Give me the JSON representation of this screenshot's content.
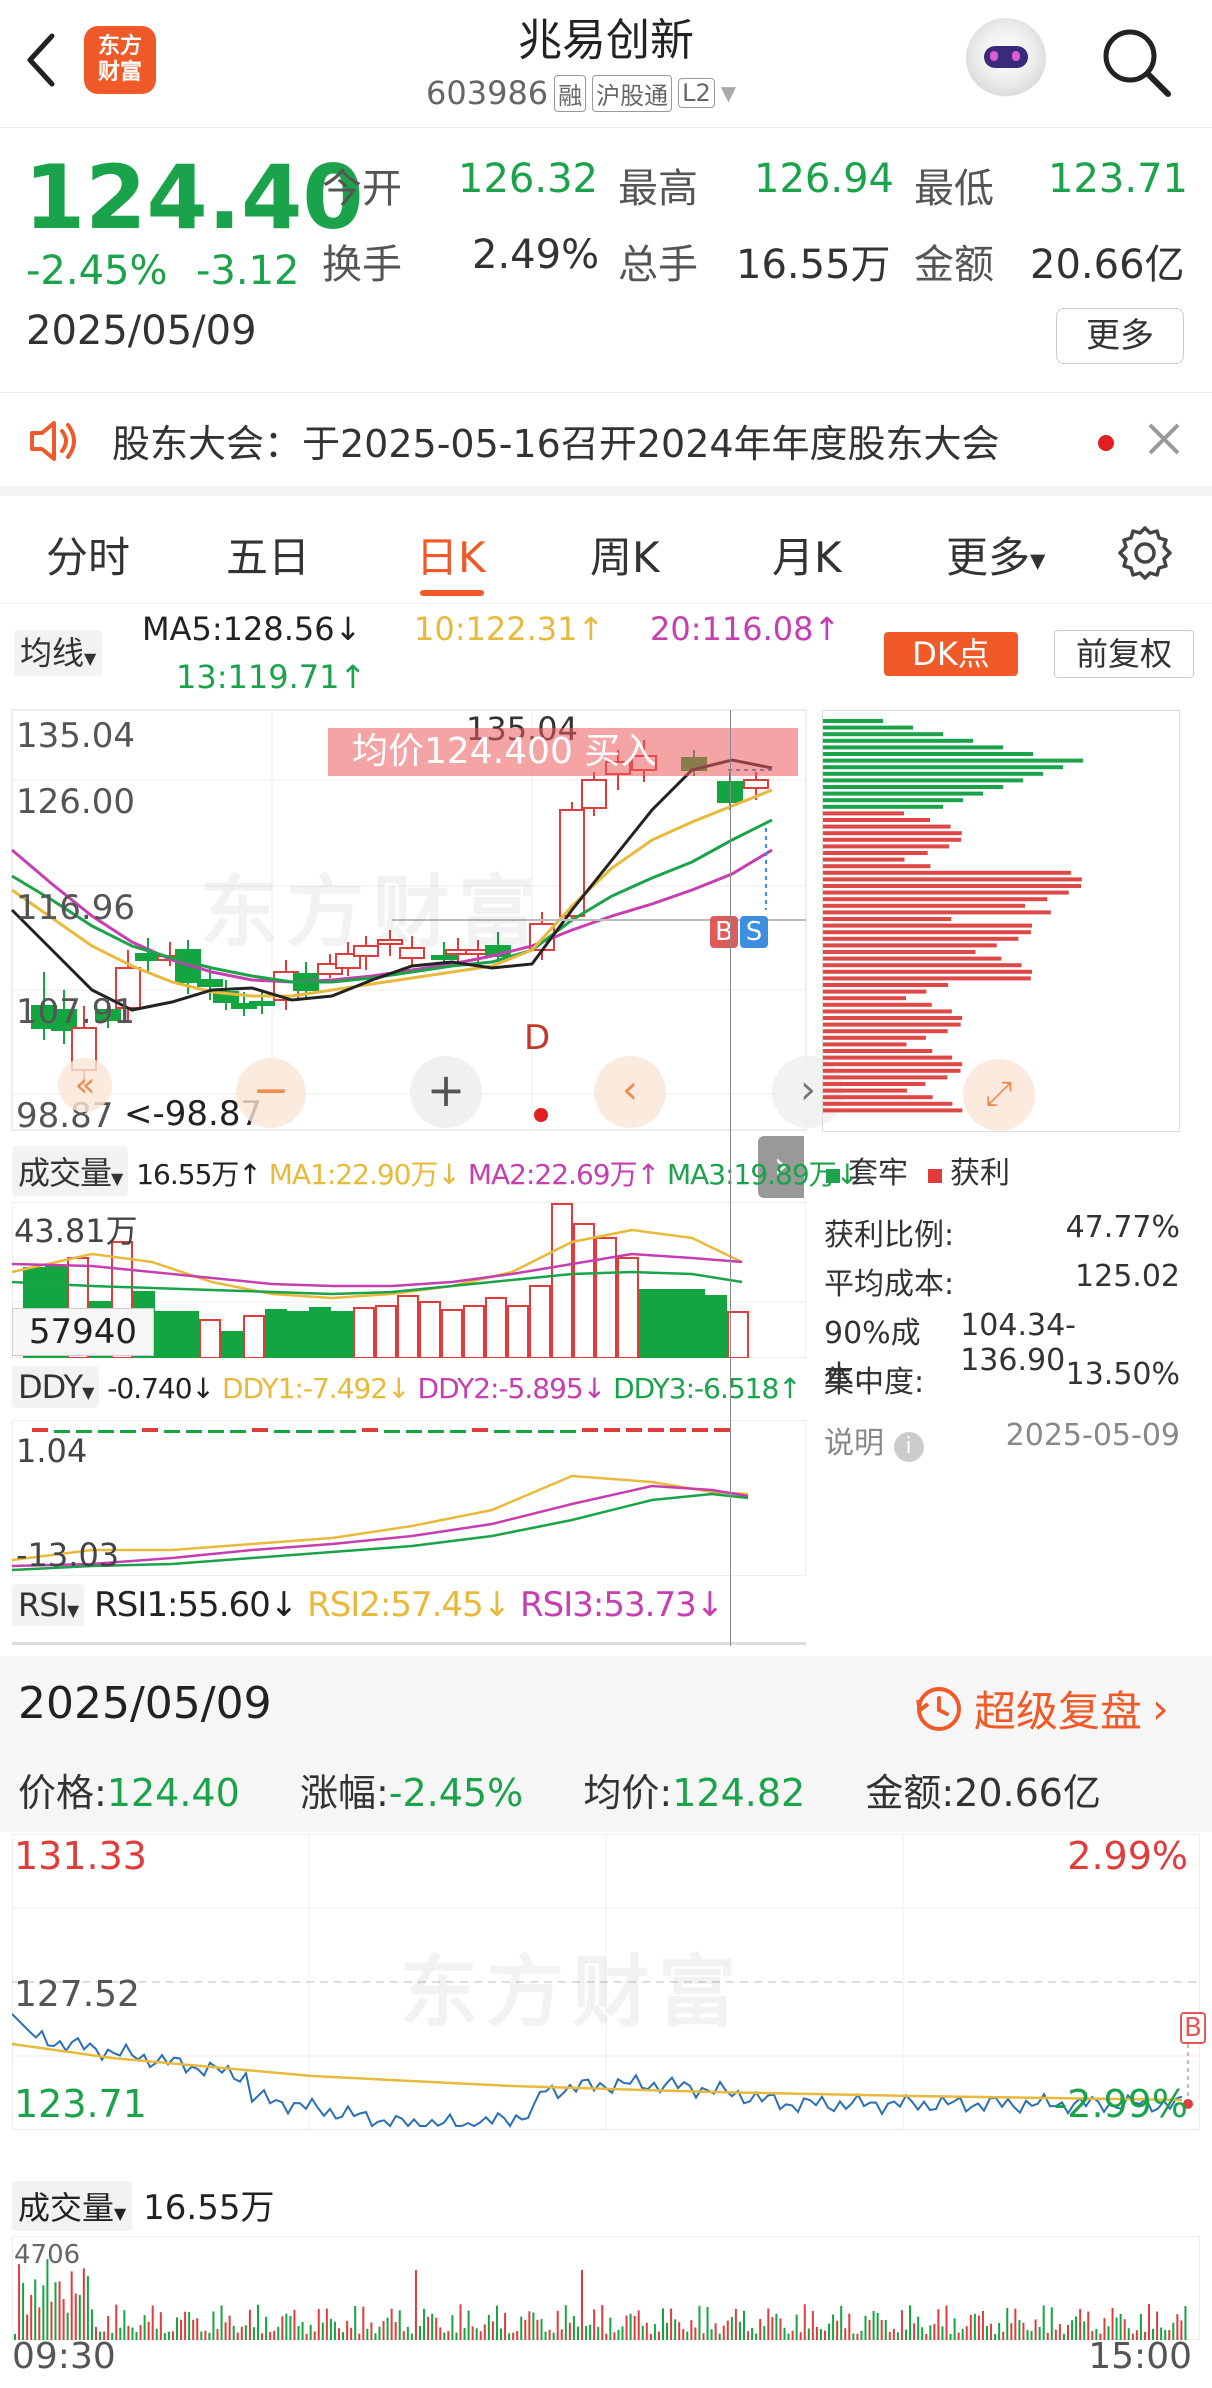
{
  "header": {
    "title": "兆易创新",
    "code": "603986",
    "badges": [
      "融",
      "沪股通",
      "L2"
    ],
    "logo_text": [
      "东方",
      "财富"
    ]
  },
  "quote": {
    "price": "124.40",
    "pct": "-2.45%",
    "chg": "-3.12",
    "date": "2025/05/09",
    "fields": [
      {
        "label": "今开",
        "value": "126.32",
        "color": "green"
      },
      {
        "label": "最高",
        "value": "126.94",
        "color": "green"
      },
      {
        "label": "最低",
        "value": "123.71",
        "color": "green"
      },
      {
        "label": "换手",
        "value": "2.49%",
        "color": "dark"
      },
      {
        "label": "总手",
        "value": "16.55万",
        "color": "dark"
      },
      {
        "label": "金额",
        "value": "20.66亿",
        "color": "dark"
      }
    ],
    "more_btn": "更多"
  },
  "notice": {
    "text": "股东大会：于2025-05-16召开2024年年度股东大会"
  },
  "tabs": [
    "分时",
    "五日",
    "日K",
    "周K",
    "月K",
    "更多"
  ],
  "active_tab": 2,
  "ma": {
    "selector": "均线",
    "ma5": "MA5:128.56↓",
    "ma10": "10:122.31↑",
    "ma20": "20:116.08↑",
    "ma13": "13:119.71↑",
    "dk": "DK点",
    "fq": "前复权"
  },
  "kchart": {
    "y_labels": [
      "135.04",
      "126.00",
      "116.96",
      "107.91",
      "98.87"
    ],
    "max_label": "135.04",
    "min_label": "<-98.87",
    "banner": "均价124.400 买入",
    "d_marker": "D",
    "b_marker": "B",
    "s_marker": "S",
    "colors": {
      "up": "#e03c3c",
      "down": "#13a53f",
      "ma5": "#222222",
      "ma10": "#e8b93a",
      "ma20": "#c63eb0",
      "ma13": "#1aa34a"
    }
  },
  "volume": {
    "selector": "成交量",
    "v": "16.55万↑",
    "ma1": "MA1:22.90万↓",
    "ma2": "MA2:22.69万↑",
    "ma3": "MA3:19.89万↓",
    "y_top": "43.81万",
    "cursor_val": "57940"
  },
  "ddy": {
    "selector": "DDY",
    "v": "-0.740↓",
    "d1": "DDY1:-7.492↓",
    "d2": "DDY2:-5.895↓",
    "d3": "DDY3:-6.518↑",
    "y_top": "1.04",
    "y_bot": "-13.03"
  },
  "rsi": {
    "selector": "RSI",
    "r1": "RSI1:55.60↓",
    "r2": "RSI2:57.45↓",
    "r3": "RSI3:53.73↓"
  },
  "chips": {
    "legend_trap": "套牢",
    "legend_profit": "获利",
    "rows": [
      {
        "label": "获利比例:",
        "value": "47.77%"
      },
      {
        "label": "平均成本:",
        "value": "125.02"
      },
      {
        "label": "90%成本:",
        "value": "104.34-136.90"
      },
      {
        "label": "集中度:",
        "value": "13.50%"
      }
    ],
    "note": "说明",
    "date": "2025-05-09"
  },
  "intraday": {
    "date": "2025/05/09",
    "replay": "超级复盘",
    "price_label": "价格:",
    "price": "124.40",
    "pct_label": "涨幅:",
    "pct": "-2.45%",
    "avg_label": "均价:",
    "avg": "124.82",
    "amt_label": "金额:",
    "amt": "20.66亿",
    "y_top": "131.33",
    "y_mid": "127.52",
    "y_bot": "123.71",
    "pct_top": "2.99%",
    "pct_bot": "-2.99%",
    "b_marker": "B",
    "vol_selector": "成交量",
    "vol_value": "16.55万",
    "vol_top": "4706",
    "t_start": "09:30",
    "t_end": "15:00"
  },
  "watermark": "东方财富"
}
